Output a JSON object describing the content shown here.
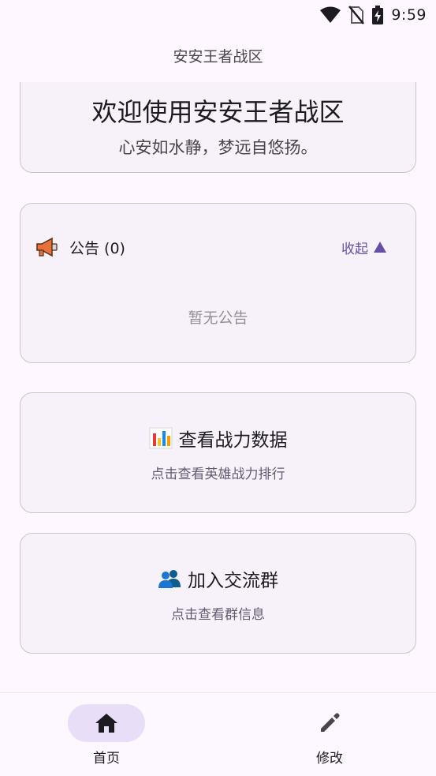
{
  "status_bar": {
    "time": "9:59"
  },
  "app_bar": {
    "title": "安安王者战区"
  },
  "welcome": {
    "title": "欢迎使用安安王者战区",
    "subtitle": "心安如水静，梦远自悠扬。"
  },
  "notice": {
    "label": "公告 (0)",
    "collapse_label": "收起",
    "empty_text": "暂无公告",
    "icon": "megaphone-icon"
  },
  "power_card": {
    "title": "查看战力数据",
    "subtitle": "点击查看英雄战力排行",
    "icon": "bar-chart-icon"
  },
  "group_card": {
    "title": "加入交流群",
    "subtitle": "点击查看群信息",
    "icon": "people-icon"
  },
  "bottom_nav": {
    "items": [
      {
        "label": "首页",
        "icon": "home-icon",
        "active": true
      },
      {
        "label": "修改",
        "icon": "pencil-icon",
        "active": false
      }
    ]
  },
  "colors": {
    "background": "#fef7ff",
    "card": "#f7f2fa",
    "accent": "#6750a4",
    "active_pill": "#e8def8"
  }
}
